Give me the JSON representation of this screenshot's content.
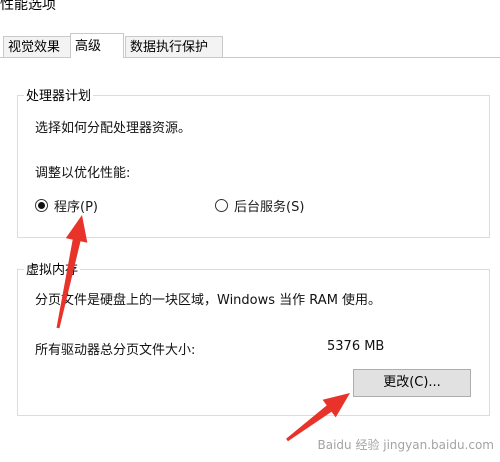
{
  "window": {
    "title": "性能选项"
  },
  "tabs": [
    {
      "label": "视觉效果"
    },
    {
      "label": "高级"
    },
    {
      "label": "数据执行保护"
    }
  ],
  "processor_scheduling": {
    "title": "处理器计划",
    "description": "选择如何分配处理器资源。",
    "adjust_label": "调整以优化性能:",
    "options": [
      {
        "label": "程序(P)",
        "selected": true
      },
      {
        "label": "后台服务(S)",
        "selected": false
      }
    ]
  },
  "virtual_memory": {
    "title": "虚拟内存",
    "description": "分页文件是硬盘上的一块区域，Windows 当作 RAM 使用。",
    "total_label": "所有驱动器总分页文件大小:",
    "total_value": "5376 MB",
    "change_button": "更改(C)..."
  },
  "annotations": {
    "arrow_color": "#e8332a",
    "watermark": "Baidu 经验 jingyan.baidu.com"
  }
}
